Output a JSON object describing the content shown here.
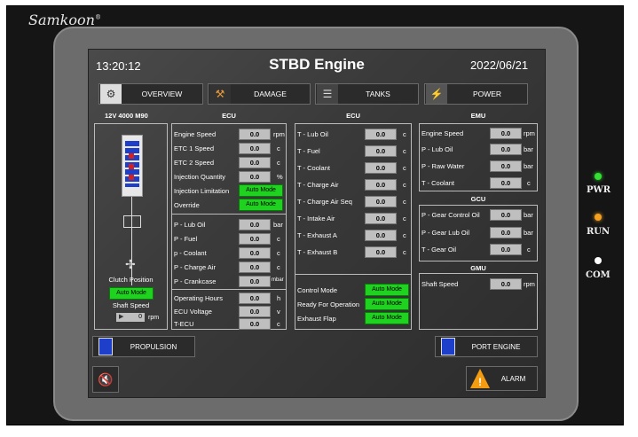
{
  "device": {
    "brand": "Samkoon",
    "brand_mark": "®",
    "indicators": [
      {
        "label": "PWR",
        "color": "#33e033"
      },
      {
        "label": "RUN",
        "color": "#f5a021"
      },
      {
        "label": "COM",
        "color": "#ffffff"
      }
    ]
  },
  "header": {
    "time": "13:20:12",
    "title": "STBD Engine",
    "date": "2022/06/21"
  },
  "nav": [
    {
      "label": "OVERVIEW",
      "icon": "wrench-circle-icon"
    },
    {
      "label": "DAMAGE",
      "icon": "crossed-tools-icon"
    },
    {
      "label": "TANKS",
      "icon": "tank-icon"
    },
    {
      "label": "POWER",
      "icon": "generator-icon"
    }
  ],
  "engine_model": "12V 4000 M90",
  "left_panel": {
    "clutch_label": "Clutch Position",
    "clutch_mode": "Auto Mode",
    "shaft_label": "Shaft Speed",
    "shaft_value": "0",
    "shaft_unit": "rpm"
  },
  "ecu1": {
    "title": "ECU",
    "group_a": [
      {
        "label": "Engine Speed",
        "value": "0.0",
        "unit": "rpm"
      },
      {
        "label": "ETC 1 Speed",
        "value": "0.0",
        "unit": "c"
      },
      {
        "label": "ETC 2 Speed",
        "value": "0.0",
        "unit": "c"
      },
      {
        "label": "Injection Quantity",
        "value": "0.0",
        "unit": "%"
      },
      {
        "label": "Injection Limitation",
        "mode": "Auto Mode"
      },
      {
        "label": "Override",
        "mode": "Auto Mode"
      }
    ],
    "group_b": [
      {
        "label": "P - Lub Oil",
        "value": "0.0",
        "unit": "bar"
      },
      {
        "label": "P - Fuel",
        "value": "0.0",
        "unit": "c"
      },
      {
        "label": "p - Coolant",
        "value": "0.0",
        "unit": "c"
      },
      {
        "label": "P - Charge Air",
        "value": "0.0",
        "unit": "c"
      },
      {
        "label": "P - Crankcase",
        "value": "0.0",
        "unit": "mbar"
      }
    ],
    "group_c": [
      {
        "label": "Operating Hours",
        "value": "0.0",
        "unit": "h"
      },
      {
        "label": "ECU Voltage",
        "value": "0.0",
        "unit": "v"
      },
      {
        "label": "T-ECU",
        "value": "0.0",
        "unit": "c"
      }
    ]
  },
  "ecu2": {
    "title": "ECU",
    "temps": [
      {
        "label": "T - Lub Oil",
        "value": "0.0",
        "unit": "c"
      },
      {
        "label": "T - Fuel",
        "value": "0.0",
        "unit": "c"
      },
      {
        "label": "T - Coolant",
        "value": "0.0",
        "unit": "c"
      },
      {
        "label": "T - Charge Air",
        "value": "0.0",
        "unit": "c"
      },
      {
        "label": "T - Charge Air Seq",
        "value": "0.0",
        "unit": "c"
      },
      {
        "label": "T - Intake Air",
        "value": "0.0",
        "unit": "c"
      },
      {
        "label": "T - Exhaust A",
        "value": "0.0",
        "unit": "c"
      },
      {
        "label": "T - Exhaust B",
        "value": "0.0",
        "unit": "c"
      }
    ],
    "modes": [
      {
        "label": "Control Mode",
        "mode": "Auto Mode"
      },
      {
        "label": "Ready For Operation",
        "mode": "Auto Mode"
      },
      {
        "label": "Exhaust Flap",
        "mode": "Auto Mode"
      }
    ]
  },
  "emu": {
    "title": "EMU",
    "rows": [
      {
        "label": "Engine Speed",
        "value": "0.0",
        "unit": "rpm"
      },
      {
        "label": "P - Lub Oil",
        "value": "0.0",
        "unit": "bar"
      },
      {
        "label": "P - Raw Water",
        "value": "0.0",
        "unit": "bar"
      },
      {
        "label": "T - Coolant",
        "value": "0.0",
        "unit": "c"
      }
    ]
  },
  "gcu": {
    "title": "GCU",
    "rows": [
      {
        "label": "P - Gear Control Oil",
        "value": "0.0",
        "unit": "bar"
      },
      {
        "label": "P - Gear Lub Oil",
        "value": "0.0",
        "unit": "bar"
      },
      {
        "label": "T - Gear Oil",
        "value": "0.0",
        "unit": "c"
      }
    ]
  },
  "gmu": {
    "title": "GMU",
    "rows": [
      {
        "label": "Shaft Speed",
        "value": "0.0",
        "unit": "rpm"
      }
    ]
  },
  "bottom": {
    "propulsion": "PROPULSION",
    "port_engine": "PORT ENGINE",
    "alarm": "ALARM"
  }
}
